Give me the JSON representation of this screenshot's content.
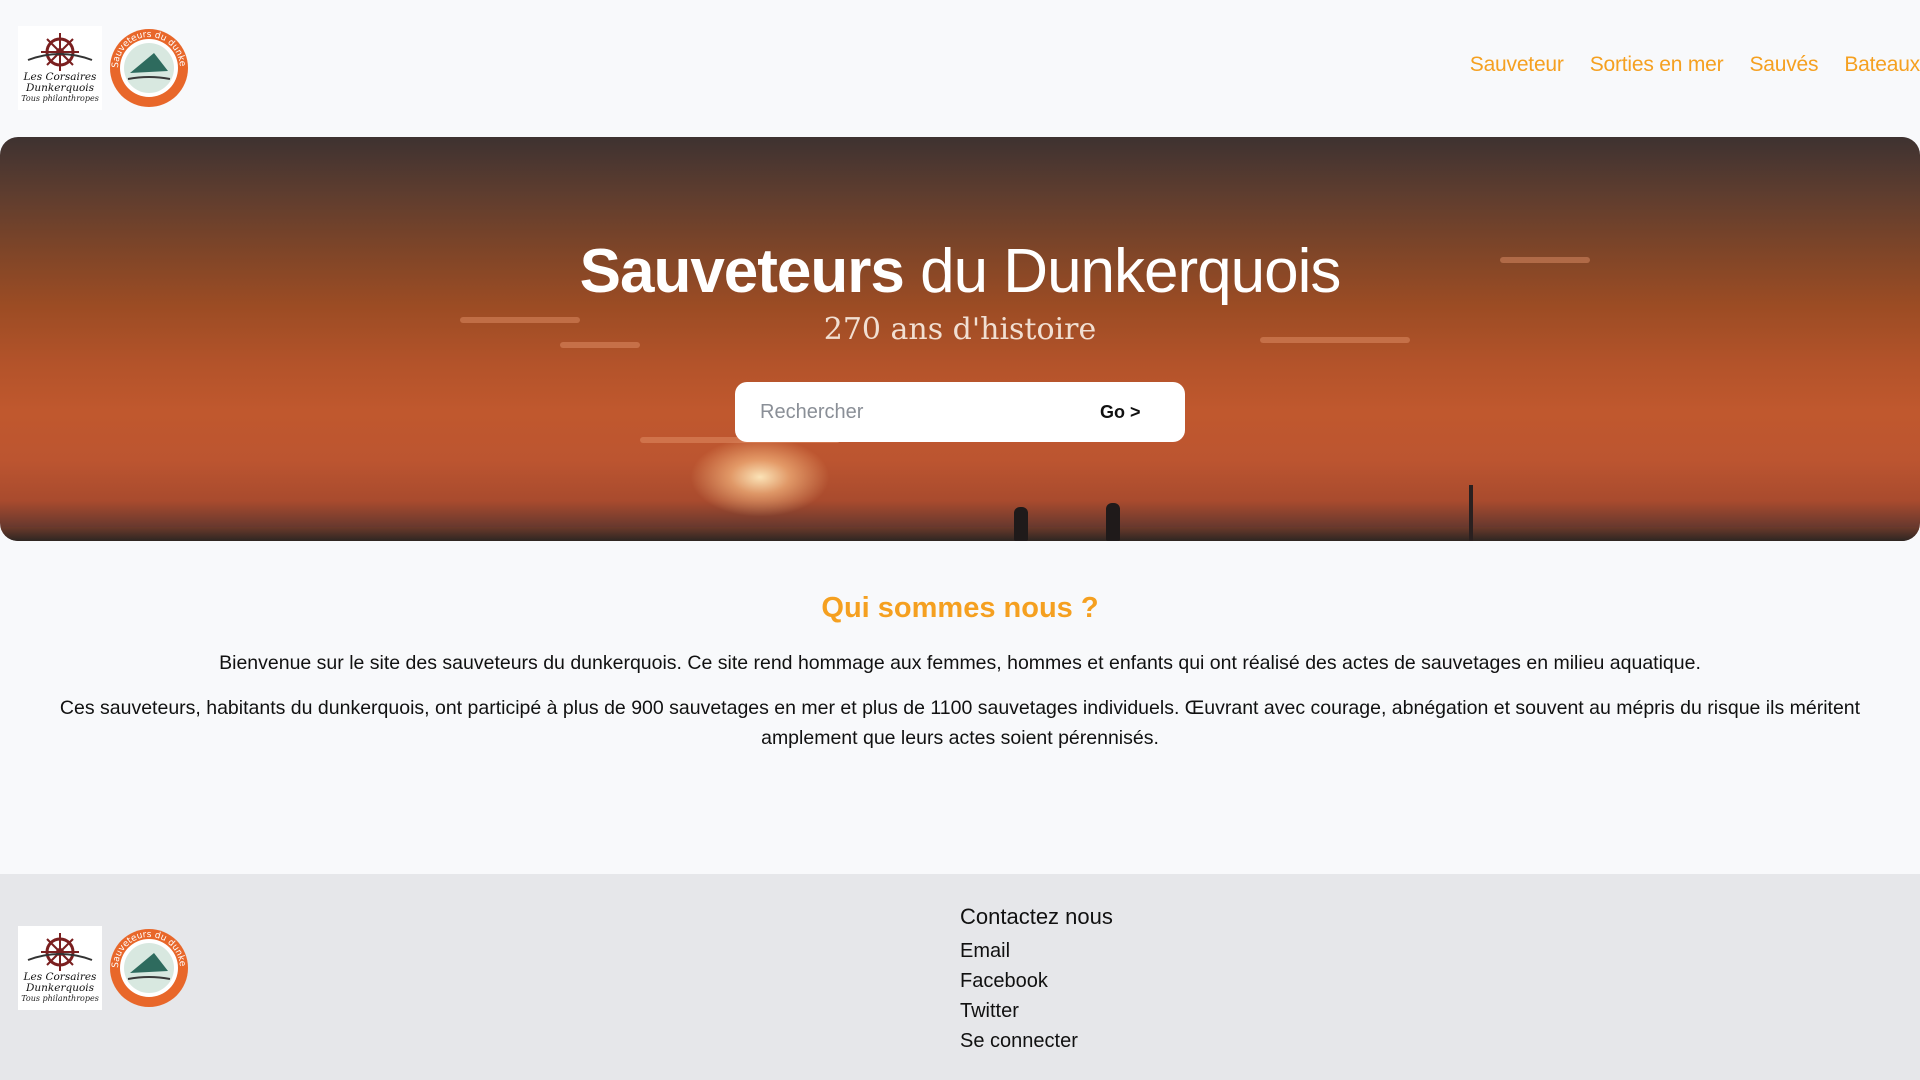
{
  "logos": {
    "corsaires": {
      "line1": "Les Corsaires",
      "line2": "Dunkerquois",
      "line3": "Tous philanthropes"
    },
    "buoy": {
      "ring_text": "Sauveteurs du dunkerquois",
      "colors": {
        "ring": "#e8672a",
        "center": "#d8e8e0"
      }
    }
  },
  "nav": {
    "items": [
      {
        "label": "Sauveteur"
      },
      {
        "label": "Sorties en mer"
      },
      {
        "label": "Sauvés"
      },
      {
        "label": "Bateaux"
      }
    ]
  },
  "hero": {
    "title_bold": "Sauveteurs",
    "title_rest": " du Dunkerquois",
    "subtitle": "270 ans d'histoire",
    "search": {
      "placeholder": "Rechercher",
      "button_label": "Go >"
    }
  },
  "about": {
    "title": "Qui sommes nous ?",
    "p1": "Bienvenue sur le site des sauveteurs du dunkerquois. Ce site rend hommage aux femmes, hommes et enfants qui ont réalisé des actes de sauvetages en milieu aquatique.",
    "p2": "Ces sauveteurs, habitants du dunkerquois, ont participé à plus de 900 sauvetages en mer et plus de 1100 sauvetages individuels. Œuvrant avec courage, abnégation et souvent au mépris du risque ils méritent amplement que leurs actes soient pérennisés."
  },
  "footer": {
    "contact_title": "Contactez nous",
    "links": [
      {
        "label": "Email"
      },
      {
        "label": "Facebook"
      },
      {
        "label": "Twitter"
      },
      {
        "label": "Se connecter"
      }
    ]
  },
  "colors": {
    "accent": "#f5a020",
    "footer_bg": "#e6e7ea",
    "page_bg": "#f8f9fb"
  }
}
